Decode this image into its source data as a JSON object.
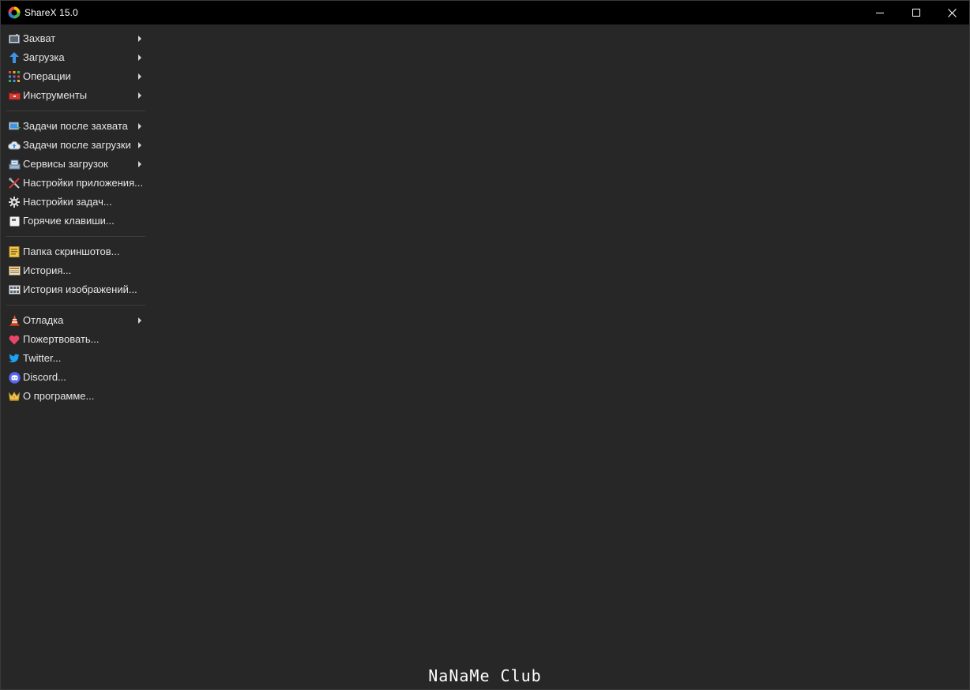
{
  "window": {
    "title": "ShareX 15.0",
    "accent_color": "#272727",
    "titlebar_color": "#000000"
  },
  "menu": {
    "groups": [
      [
        {
          "label": "Захват",
          "icon": "camera-icon",
          "submenu": true
        },
        {
          "label": "Загрузка",
          "icon": "upload-arrow-icon",
          "submenu": true
        },
        {
          "label": "Операции",
          "icon": "grid-icon",
          "submenu": true
        },
        {
          "label": "Инструменты",
          "icon": "toolbox-icon",
          "submenu": true
        }
      ],
      [
        {
          "label": "Задачи после захвата",
          "icon": "after-capture-icon",
          "submenu": true
        },
        {
          "label": "Задачи после загрузки",
          "icon": "cloud-upload-icon",
          "submenu": true
        },
        {
          "label": "Сервисы загрузок",
          "icon": "upload-services-icon",
          "submenu": true
        },
        {
          "label": "Настройки приложения...",
          "icon": "tools-wrench-icon",
          "submenu": false
        },
        {
          "label": "Настройки задач...",
          "icon": "gear-icon",
          "submenu": false
        },
        {
          "label": "Горячие клавиши...",
          "icon": "keyboard-key-icon",
          "submenu": false
        }
      ],
      [
        {
          "label": "Папка скриншотов...",
          "icon": "folder-icon",
          "submenu": false
        },
        {
          "label": "История...",
          "icon": "history-icon",
          "submenu": false
        },
        {
          "label": "История изображений...",
          "icon": "image-history-icon",
          "submenu": false
        }
      ],
      [
        {
          "label": "Отладка",
          "icon": "traffic-cone-icon",
          "submenu": true
        },
        {
          "label": "Пожертвовать...",
          "icon": "heart-icon",
          "submenu": false
        },
        {
          "label": "Twitter...",
          "icon": "twitter-icon",
          "submenu": false
        },
        {
          "label": "Discord...",
          "icon": "discord-icon",
          "submenu": false
        },
        {
          "label": "О программе...",
          "icon": "crown-icon",
          "submenu": false
        }
      ]
    ]
  },
  "watermark": "NaNaMe Club"
}
